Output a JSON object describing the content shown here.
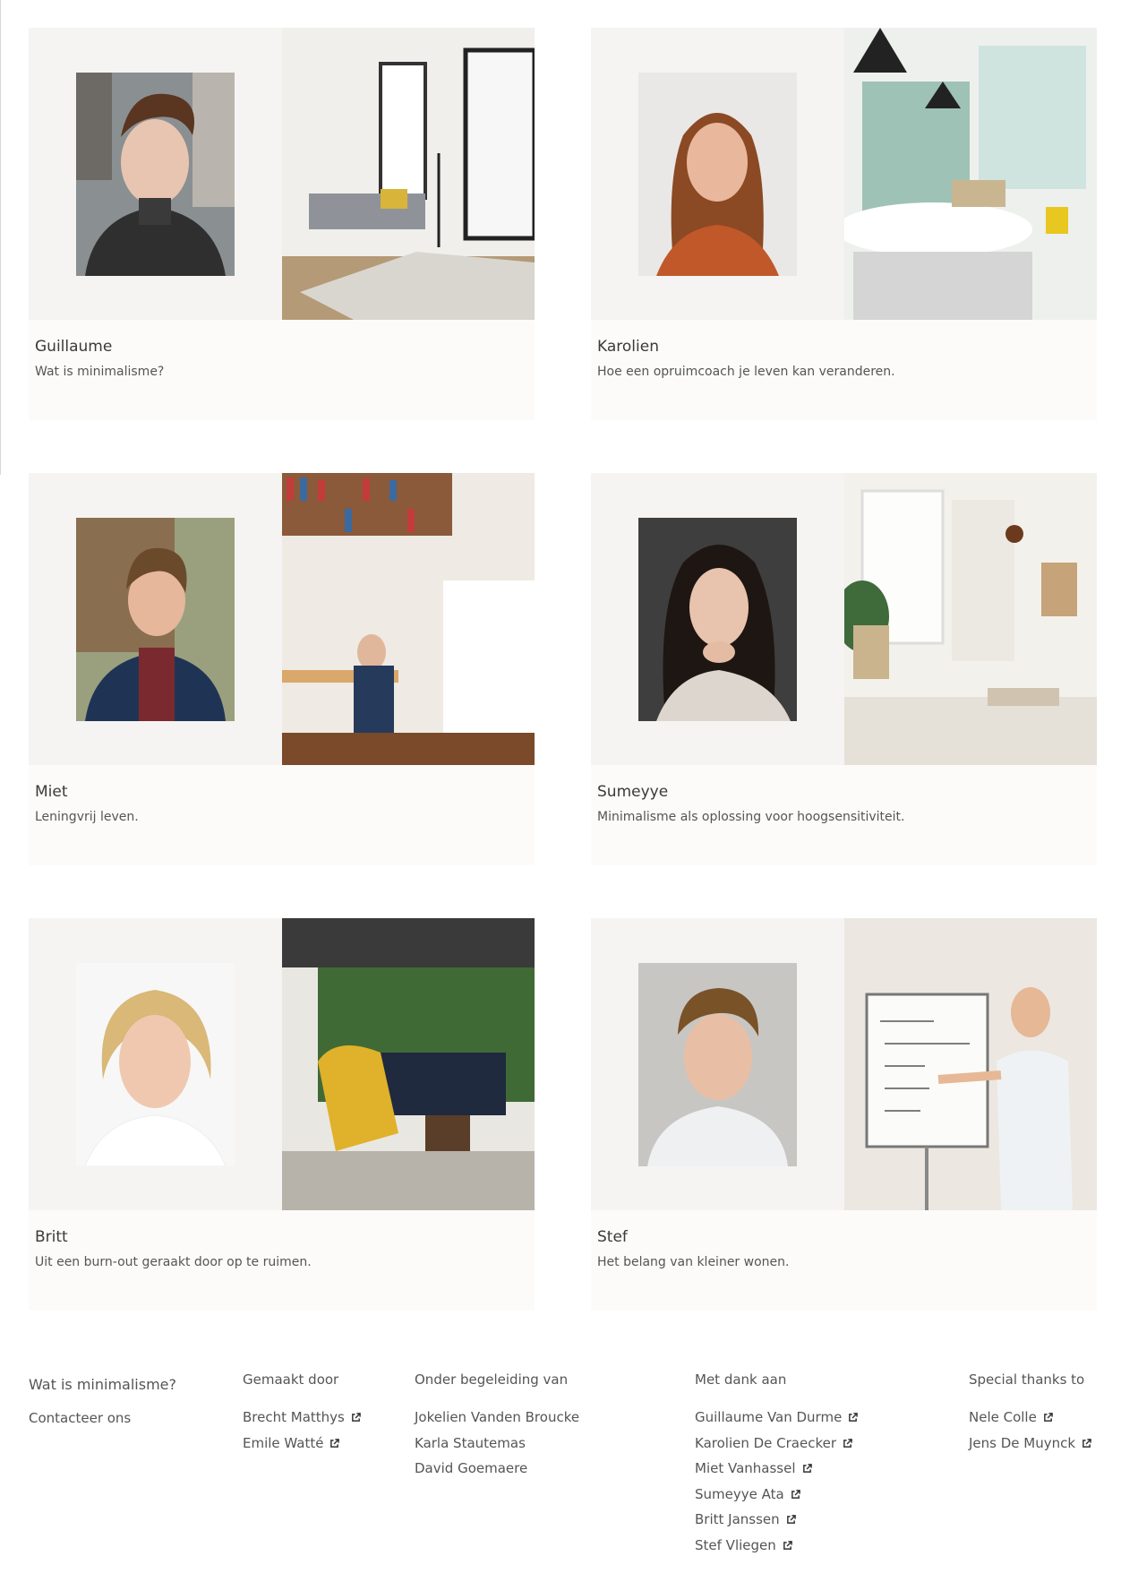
{
  "cards": [
    {
      "name": "Guillaume",
      "tagline": "Wat is minimalisme?"
    },
    {
      "name": "Karolien",
      "tagline": "Hoe een opruimcoach je leven kan veranderen."
    },
    {
      "name": "Miet",
      "tagline": "Leningvrij leven."
    },
    {
      "name": "Sumeyye",
      "tagline": "Minimalisme als oplossing voor hoogsensitiviteit."
    },
    {
      "name": "Britt",
      "tagline": "Uit een burn-out geraakt door op te ruimen."
    },
    {
      "name": "Stef",
      "tagline": "Het belang van kleiner wonen."
    }
  ],
  "footer": {
    "nav": {
      "what": "Wat is minimalisme?",
      "contact": "Contacteer ons"
    },
    "made_by": {
      "head": "Gemaakt door",
      "people": [
        "Brecht Matthys",
        "Emile Watté"
      ]
    },
    "guided_by": {
      "head": "Onder begeleiding van",
      "people": [
        "Jokelien Vanden Broucke",
        "Karla Stautemas",
        "David Goemaere"
      ]
    },
    "thanks": {
      "head": "Met dank aan",
      "people": [
        "Guillaume Van Durme",
        "Karolien De Craecker",
        "Miet Vanhassel",
        "Sumeyye Ata",
        "Britt Janssen",
        "Stef Vliegen"
      ]
    },
    "special": {
      "head": "Special thanks to",
      "people": [
        "Nele Colle",
        "Jens De Muynck"
      ]
    }
  },
  "colors": {
    "card_bg": "#fcfbfa",
    "portrait_bg": "#f5f4f2",
    "text": "#3c3c3c"
  },
  "icons": {
    "external_link": "external-link-icon"
  }
}
